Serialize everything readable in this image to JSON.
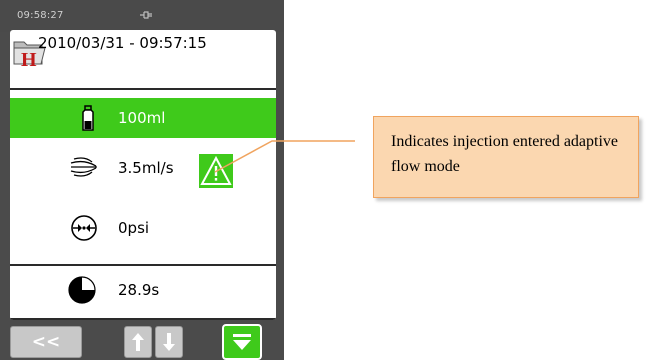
{
  "status_bar": {
    "time": "09:58:27"
  },
  "header": {
    "datetime": "2010/03/31 - 09:57:15"
  },
  "params": [
    {
      "key": "volume",
      "value": "100ml",
      "icon": "bottle-icon",
      "active": true
    },
    {
      "key": "flow_rate",
      "value": "3.5ml/s",
      "icon": "flow-lines-icon",
      "active": false
    },
    {
      "key": "pressure",
      "value": "0psi",
      "icon": "pressure-gauge-icon",
      "active": false
    },
    {
      "key": "duration",
      "value": "28.9s",
      "icon": "pie-timer-icon",
      "active": false
    }
  ],
  "warning": {
    "icon": "warning-triangle-icon"
  },
  "nav": {
    "back_label": "<<",
    "up_icon": "arrow-up-icon",
    "down_icon": "arrow-down-icon",
    "collapse_icon": "collapse-down-icon"
  },
  "callout": {
    "text": "Indicates injection entered adaptive flow mode"
  },
  "colors": {
    "accent_green": "#3fca1b",
    "callout_fill": "#fbd7b0",
    "callout_border": "#f0a45f",
    "device_frame": "#4b4b4b"
  }
}
